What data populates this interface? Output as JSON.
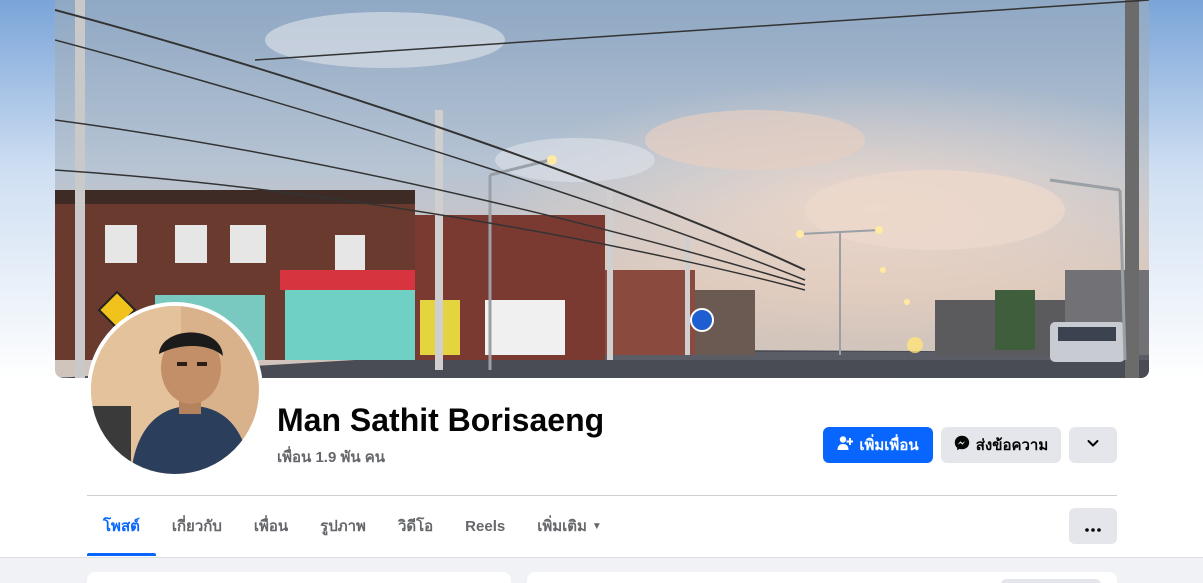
{
  "profile": {
    "name": "Man Sathit Borisaeng",
    "friends": "เพื่อน 1.9 พัน คน"
  },
  "actions": {
    "add_friend": "เพิ่มเพื่อน",
    "message": "ส่งข้อความ"
  },
  "tabs": [
    {
      "label": "โพสต์",
      "active": true
    },
    {
      "label": "เกี่ยวกับ",
      "active": false
    },
    {
      "label": "เพื่อน",
      "active": false
    },
    {
      "label": "รูปภาพ",
      "active": false
    },
    {
      "label": "วิดีโอ",
      "active": false
    },
    {
      "label": "Reels",
      "active": false
    },
    {
      "label": "เพิ่มเติม",
      "active": false
    }
  ],
  "icons": {
    "add_friend": "person-plus-icon",
    "message": "messenger-icon",
    "more": "chevron-down-icon",
    "overflow": "ellipsis-icon",
    "tab_more": "caret-down-icon"
  },
  "colors": {
    "accent": "#0866ff",
    "button_gray": "#e4e6eb",
    "text_primary": "#050505",
    "text_secondary": "#65676b",
    "feed_bg": "#f0f2f5"
  }
}
